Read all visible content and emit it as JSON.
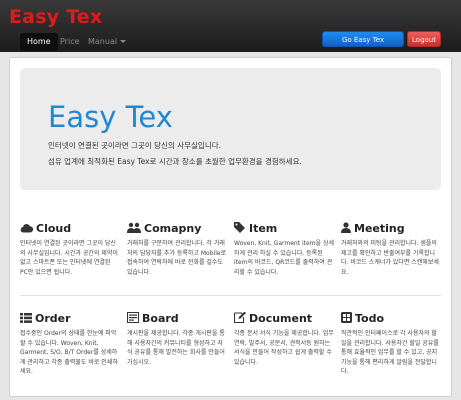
{
  "brand": "Easy Tex",
  "nav": {
    "home": "Home",
    "price": "Price",
    "manual": "Manual"
  },
  "buttons": {
    "go": "Go Easy Tex",
    "logout": "Logout"
  },
  "hero": {
    "title": "Easy Tex",
    "line1": "인터넷이 연결된 곳이라면 그곳이 당신의 사무실입니다.",
    "line2": "섬유 업계에 최적화된 Easy Tex로 시간과 장소를 초월한 업무환경을 경험하세요."
  },
  "features": [
    {
      "icon": "cloud-icon",
      "title": "Cloud",
      "desc": "인터넷이 연결된 곳이라면 그곳이 당신의 사무실입니다. 시간과 공간의 제약이 없고 스마트폰 또는 인터넷에 연결된 PC만 있으면 됩니다."
    },
    {
      "icon": "users-icon",
      "title": "Comapny",
      "desc": "거래처를 구분하여 관리합니다. 각 거래처의 담당자를 추가 등록하고 Mobile로 접속하여 연락처에 바로 전화를 걸수도 있습니다."
    },
    {
      "icon": "tags-icon",
      "title": "Item",
      "desc": "Woven, Knit, Garment item을 상세하게 관리 하실 수 있습니다. 등록된 item의 바코드, QR코드를 출력하여 관리할 수 있습니다."
    },
    {
      "icon": "user-icon",
      "title": "Meeting",
      "desc": "거래처와의 미팅을 관리합니다. 샘플의 제고를 확인하고 반출여부를 기록합니다. 바코드 스캐너가 있다면 스캔해보세요."
    },
    {
      "icon": "list-icon",
      "title": "Order",
      "desc": "접수중인 Order의 상태를 한눈에 파악할 수 있습니다. Woven, Knit, Garment, S/O, B/T Order를 상세하게 관리하고 각종 출력물도 바로 인쇄하세요."
    },
    {
      "icon": "board-icon",
      "title": "Board",
      "desc": "게시판을 제공합니다. 각종 게시판을 통해 사용자간의 커뮤니티를 형성하고 자식 공유를 통해 발전하는 회사를 만들어 가십시오."
    },
    {
      "icon": "document-icon",
      "title": "Document",
      "desc": "각종 문서 서식 기능을 제공합니다. 업무연락, 발주서, 공문서, 견적서등 원하는 서식을 만들어 작성하고 쉽게 출력할 수 있습니다."
    },
    {
      "icon": "todo-icon",
      "title": "Todo",
      "desc": "직관적인 인터페이스로 각 사용자의 할일을 관리합니다. 사용자간 할일 공유를 통해 효율적인 업무를 할 수 있고, 공지 기능을 통해 편리하게 알림을 전달합니다."
    }
  ]
}
